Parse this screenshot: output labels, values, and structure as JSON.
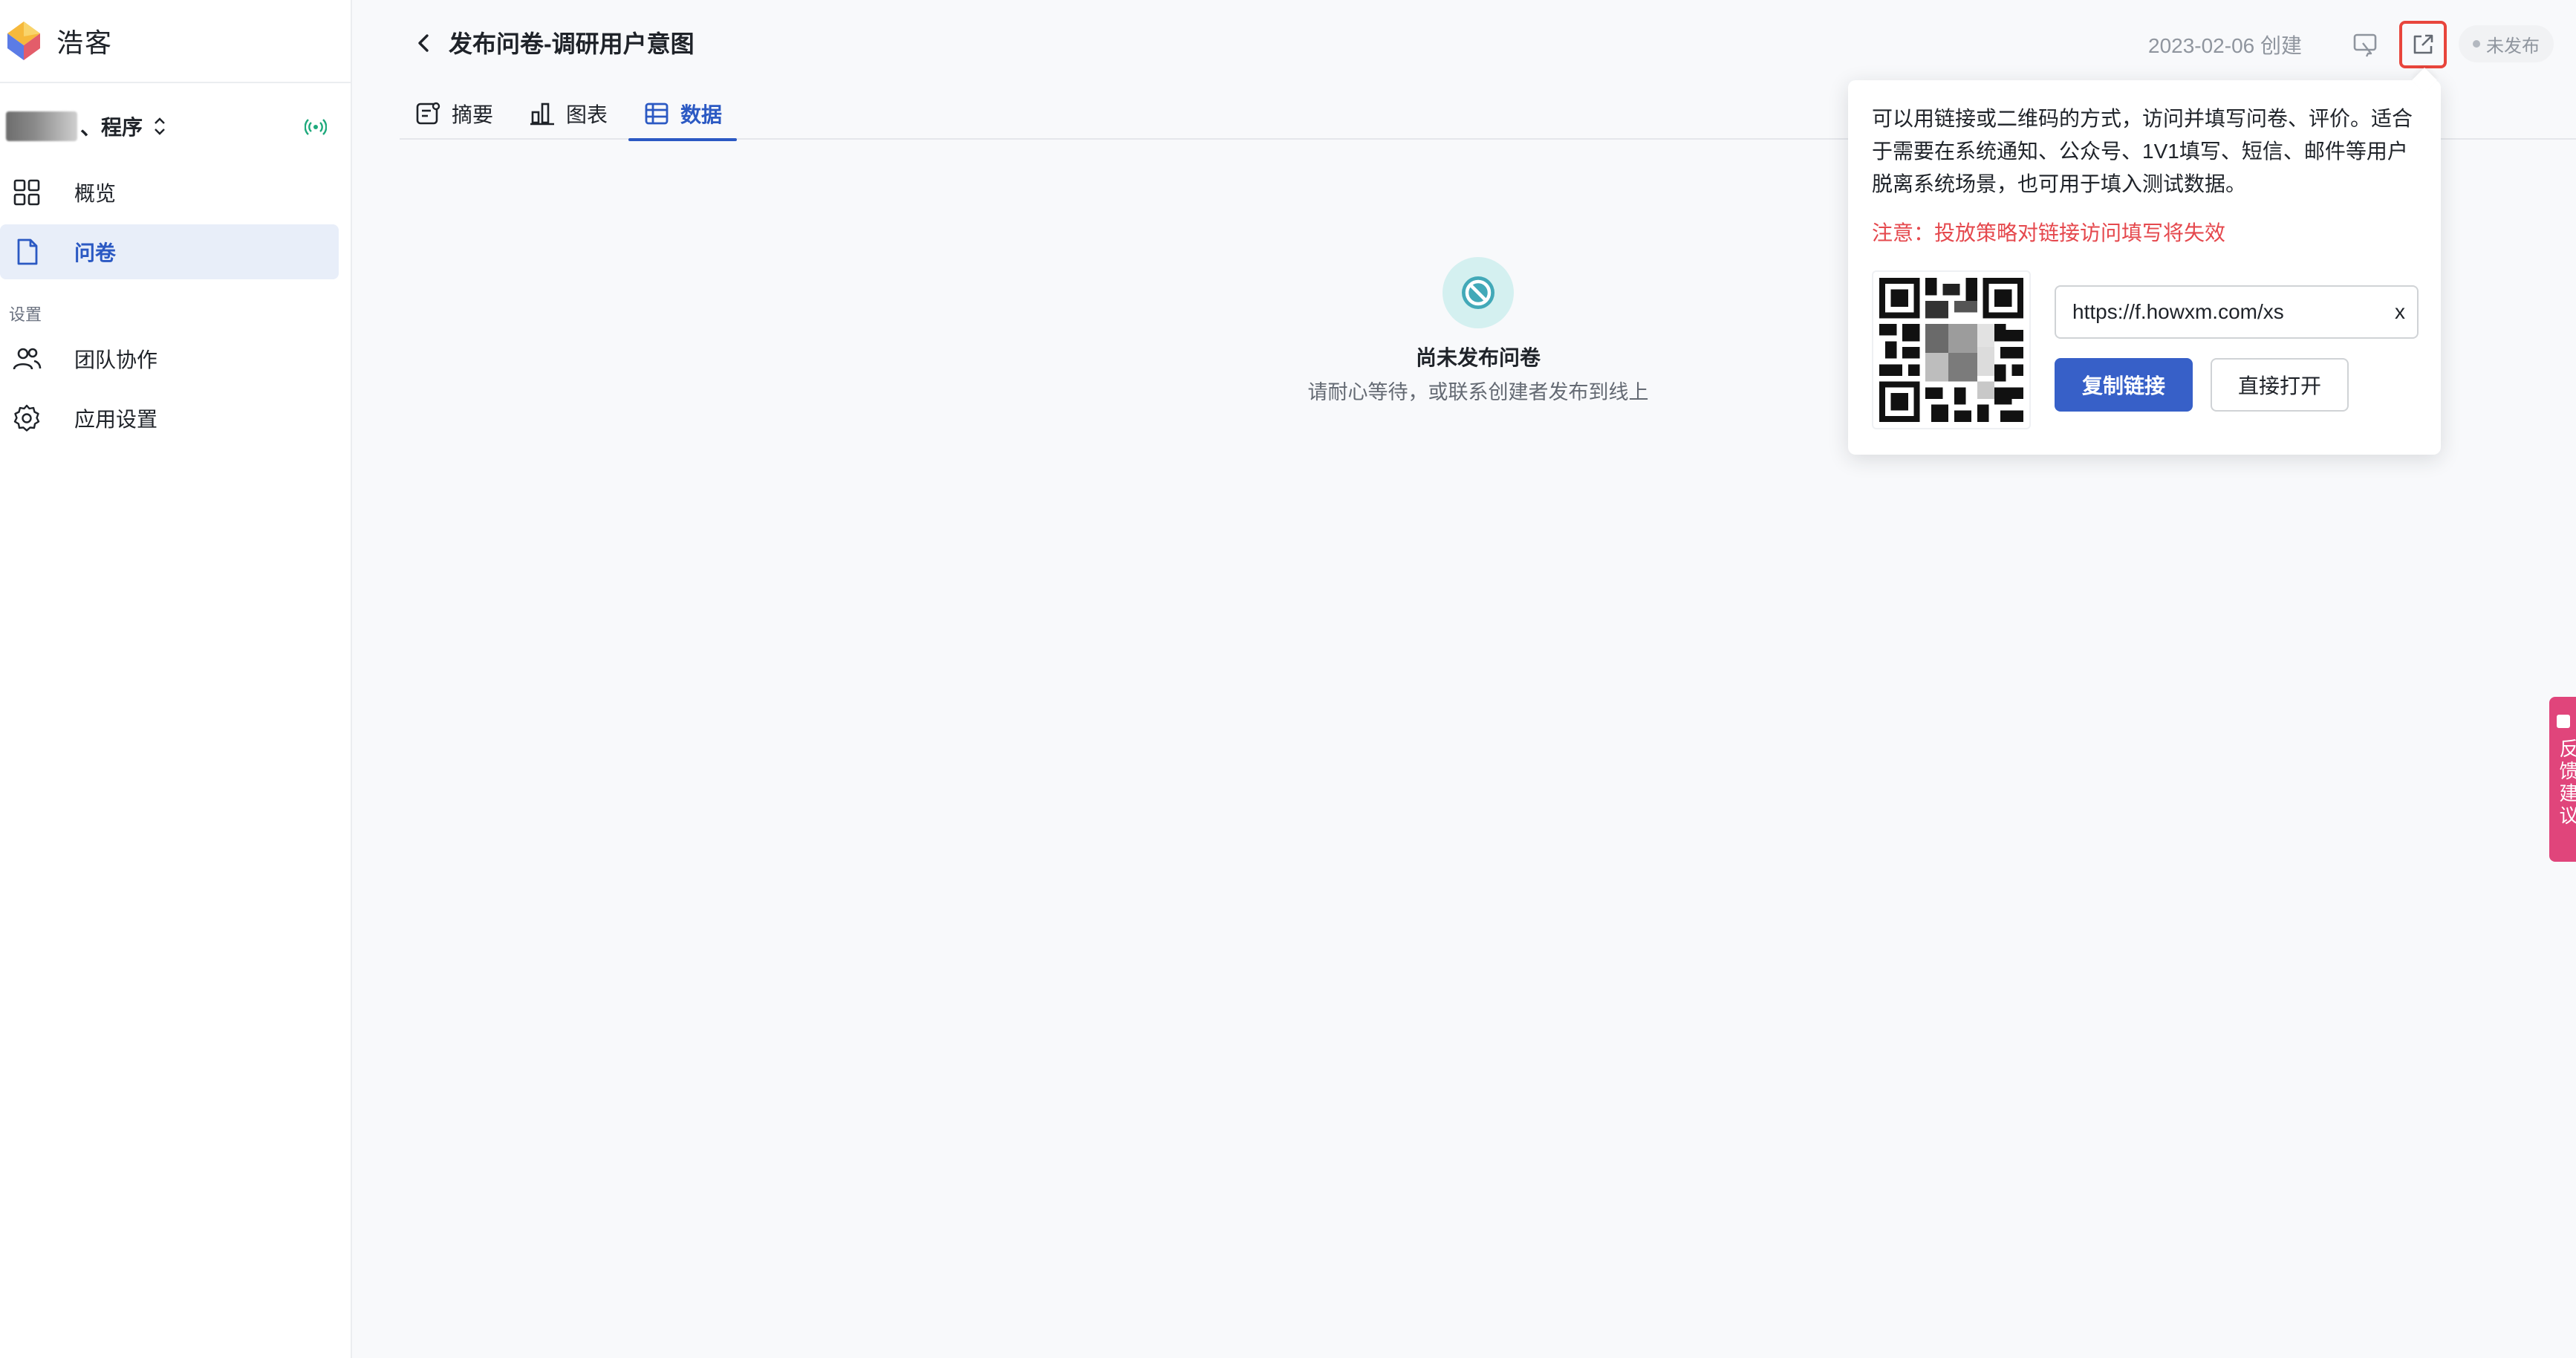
{
  "app": {
    "brand_name": "浩客",
    "current_app_name": "、程序"
  },
  "sidebar": {
    "items": [
      {
        "label": "概览",
        "icon": "grid-icon",
        "active": false
      },
      {
        "label": "问卷",
        "icon": "document-icon",
        "active": true
      }
    ],
    "settings_section_label": "设置",
    "settings_items": [
      {
        "label": "团队协作",
        "icon": "team-icon"
      },
      {
        "label": "应用设置",
        "icon": "gear-icon"
      }
    ]
  },
  "header": {
    "title": "发布问卷-调研用户意图",
    "created": "2023-02-06 创建",
    "status": "未发布"
  },
  "tabs": [
    {
      "label": "摘要",
      "icon": "summary-icon",
      "active": false
    },
    {
      "label": "图表",
      "icon": "bar-chart-icon",
      "active": false
    },
    {
      "label": "数据",
      "icon": "table-icon",
      "active": true
    }
  ],
  "empty_state": {
    "title": "尚未发布问卷",
    "description": "请耐心等待，或联系创建者发布到线上"
  },
  "share_popover": {
    "description": "可以用链接或二维码的方式，访问并填写问卷、评价。适合于需要在系统通知、公众号、1V1填写、短信、邮件等用户脱离系统场景，也可用于填入测试数据。",
    "warning": "注意：投放策略对链接访问填写将失效",
    "link_value": "https://f.howxm.com/xs",
    "clear_label": "x",
    "copy_button": "复制链接",
    "open_button": "直接打开"
  },
  "feedback": {
    "label": "反馈建议"
  },
  "colors": {
    "primary": "#3760c8",
    "active_text": "#2b59c3",
    "active_bg": "#e8eef9",
    "warning": "#e5484d",
    "highlight_border": "#e8453c",
    "feedback_tab": "#e0457b"
  }
}
